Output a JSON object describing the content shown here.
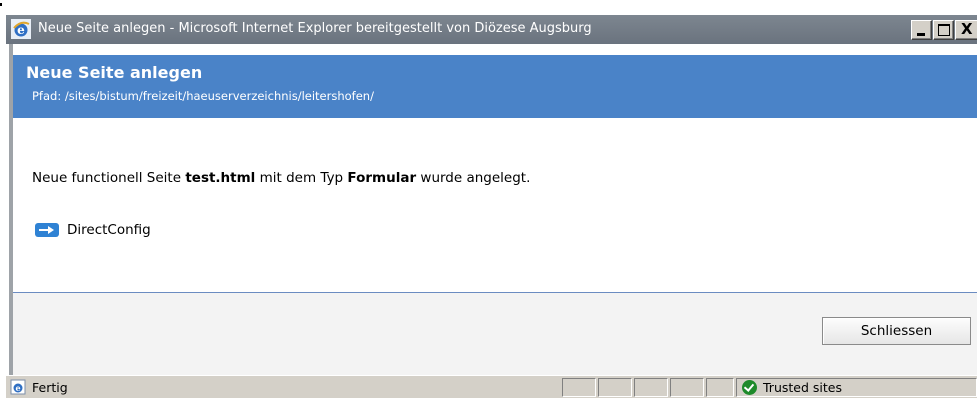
{
  "window": {
    "title": "Neue Seite anlegen - Microsoft Internet Explorer bereitgestellt von Diözese Augsburg",
    "controls": {
      "close_glyph": "X"
    }
  },
  "header": {
    "title": "Neue Seite anlegen",
    "path": "Pfad: /sites/bistum/freizeit/haeuserverzeichnis/leitershofen/"
  },
  "message": {
    "prefix": "Neue functionell Seite ",
    "filename": "test.html",
    "middle": " mit dem Typ ",
    "type": "Formular",
    "suffix": " wurde angelegt."
  },
  "link": {
    "label": "DirectConfig",
    "icon": "arrow-right-icon"
  },
  "footer": {
    "close_label": "Schliessen"
  },
  "statusbar": {
    "status": "Fertig",
    "zone": "Trusted sites",
    "icons": {
      "status": "ie-page-icon",
      "zone": "trusted-check-icon"
    }
  },
  "colors": {
    "header_bg": "#4a83c8",
    "titlebar_bg": "#6f7882",
    "footer_bg": "#f3f3f3",
    "link_icon": "#2f82d4",
    "zone_icon": "#1e8a2a"
  }
}
